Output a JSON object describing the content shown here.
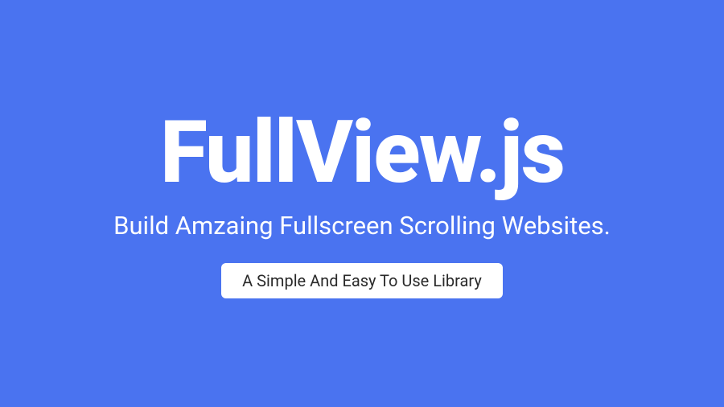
{
  "hero": {
    "title": "FullView.js",
    "subtitle": "Build Amzaing Fullscreen Scrolling Websites.",
    "badge_label": "A Simple And Easy To Use Library"
  }
}
